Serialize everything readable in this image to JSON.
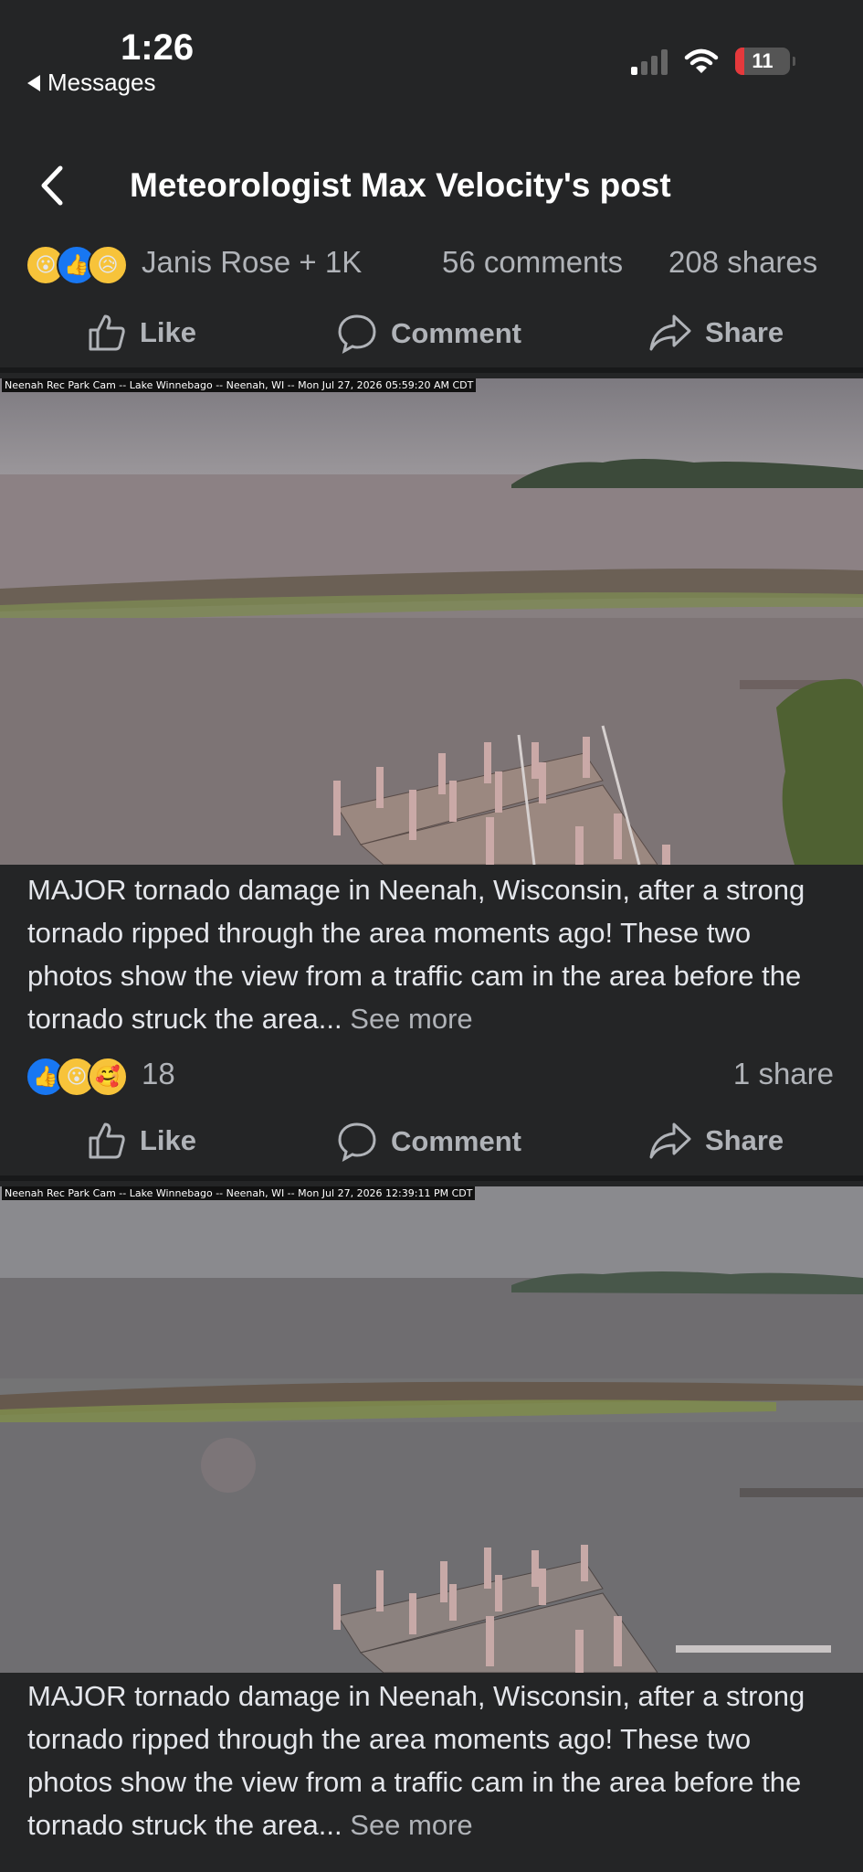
{
  "status": {
    "time": "1:26",
    "back_app": "Messages",
    "battery": "11"
  },
  "header": {
    "title": "Meteorologist Max Velocity's post"
  },
  "post_stats": {
    "reactor": "Janis Rose + 1K",
    "comments": "56 comments",
    "shares": "208 shares"
  },
  "actions": {
    "like": "Like",
    "comment": "Comment",
    "share": "Share"
  },
  "photos": [
    {
      "timestamp": "Neenah Rec Park Cam -- Lake Winnebago -- Neenah, WI -- Mon Jul 27, 2026 05:59:20 AM CDT",
      "caption": "MAJOR tornado damage in Neenah, Wisconsin, after a strong tornado ripped through the area moments ago! These two photos show the view from a traffic cam in the area before the tornado struck the area...",
      "see_more": "See more",
      "reaction_count": "18",
      "share_count": "1 share"
    },
    {
      "timestamp": "Neenah Rec Park Cam -- Lake Winnebago -- Neenah, WI -- Mon Jul 27, 2026 12:39:11 PM CDT",
      "caption": "MAJOR tornado damage in Neenah, Wisconsin, after a strong tornado ripped through the area moments ago! These two photos show the view from a traffic cam in the area before the tornado struck the area...",
      "see_more": "See more"
    }
  ],
  "icons": {
    "back": "chevron-left-icon",
    "like": "thumbs-up-icon",
    "comment": "speech-bubble-icon",
    "share": "share-arrow-icon"
  },
  "colors": {
    "background": "#242526",
    "like_blue": "#1877f2",
    "battery_red": "#e5393c"
  }
}
